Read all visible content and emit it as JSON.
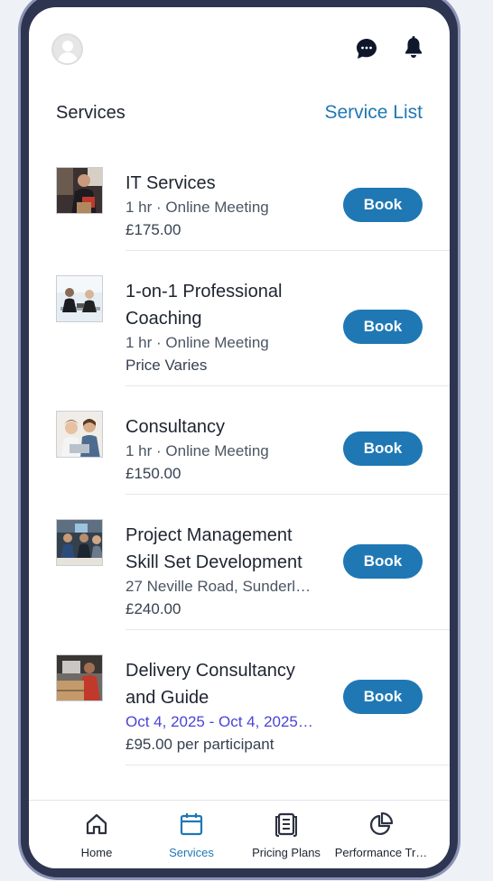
{
  "header": {
    "section_title": "Services",
    "section_link": "Service List"
  },
  "services": [
    {
      "title": "IT Services",
      "sub": "1 hr · Online Meeting",
      "price": "£175.00",
      "button": "Book"
    },
    {
      "title": "1-on-1 Professional Coaching",
      "sub": "1 hr · Online Meeting",
      "price": "Price Varies",
      "button": "Book"
    },
    {
      "title": "Consultancy",
      "sub": "1 hr · Online Meeting",
      "price": "£150.00",
      "button": "Book"
    },
    {
      "title": "Project Management Skill Set Development",
      "sub": "27 Neville Road, Sunderla…",
      "price": "£240.00",
      "button": "Book"
    },
    {
      "title": "Delivery Consultancy and Guide",
      "sub": "Oct 4, 2025 - Oct 4, 2025 …",
      "price": "£95.00 per participant",
      "button": "Book"
    }
  ],
  "tabs": [
    {
      "label": "Home",
      "icon": "home-icon"
    },
    {
      "label": "Services",
      "icon": "calendar-icon"
    },
    {
      "label": "Pricing Plans",
      "icon": "document-icon"
    },
    {
      "label": "Performance Tr…",
      "icon": "pie-chart-icon"
    }
  ],
  "colors": {
    "accent": "#1f78b4",
    "date_text": "#4a44d6",
    "frame": "#2d3550"
  }
}
